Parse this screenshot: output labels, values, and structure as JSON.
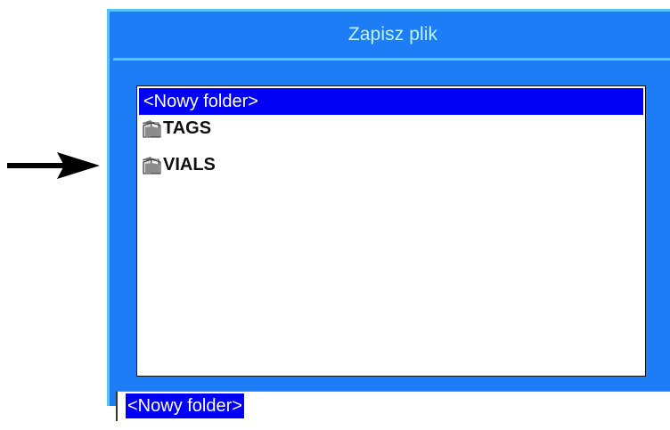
{
  "dialog": {
    "title": "Zapisz plik"
  },
  "file_list": {
    "items": [
      {
        "label": "<Nowy folder>",
        "type": "new-folder",
        "selected": true,
        "icon": ""
      },
      {
        "label": "TAGS",
        "type": "folder",
        "selected": false,
        "icon": "folder-icon"
      },
      {
        "label": "VIALS",
        "type": "folder",
        "selected": false,
        "icon": "folder-icon"
      }
    ]
  },
  "filename_input": {
    "value": "<Nowy folder>"
  },
  "colors": {
    "dialog_blue": "#1d7df7",
    "border_light_blue": "#58c3fb",
    "title_text": "#bff4ff",
    "selection_blue": "#0000f5"
  },
  "annotation": {
    "icon": "right-arrow-icon"
  }
}
